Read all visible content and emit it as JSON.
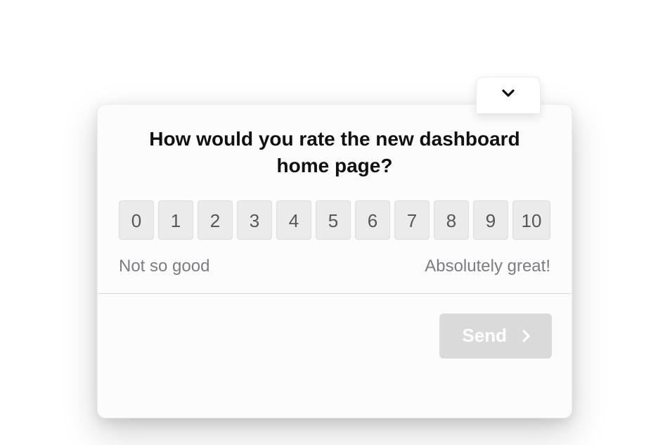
{
  "survey": {
    "question": "How would you rate the new dashboard home page?",
    "rating_values": [
      "0",
      "1",
      "2",
      "3",
      "4",
      "5",
      "6",
      "7",
      "8",
      "9",
      "10"
    ],
    "legend_low": "Not so good",
    "legend_high": "Absolutely great!",
    "send_label": "Send"
  }
}
